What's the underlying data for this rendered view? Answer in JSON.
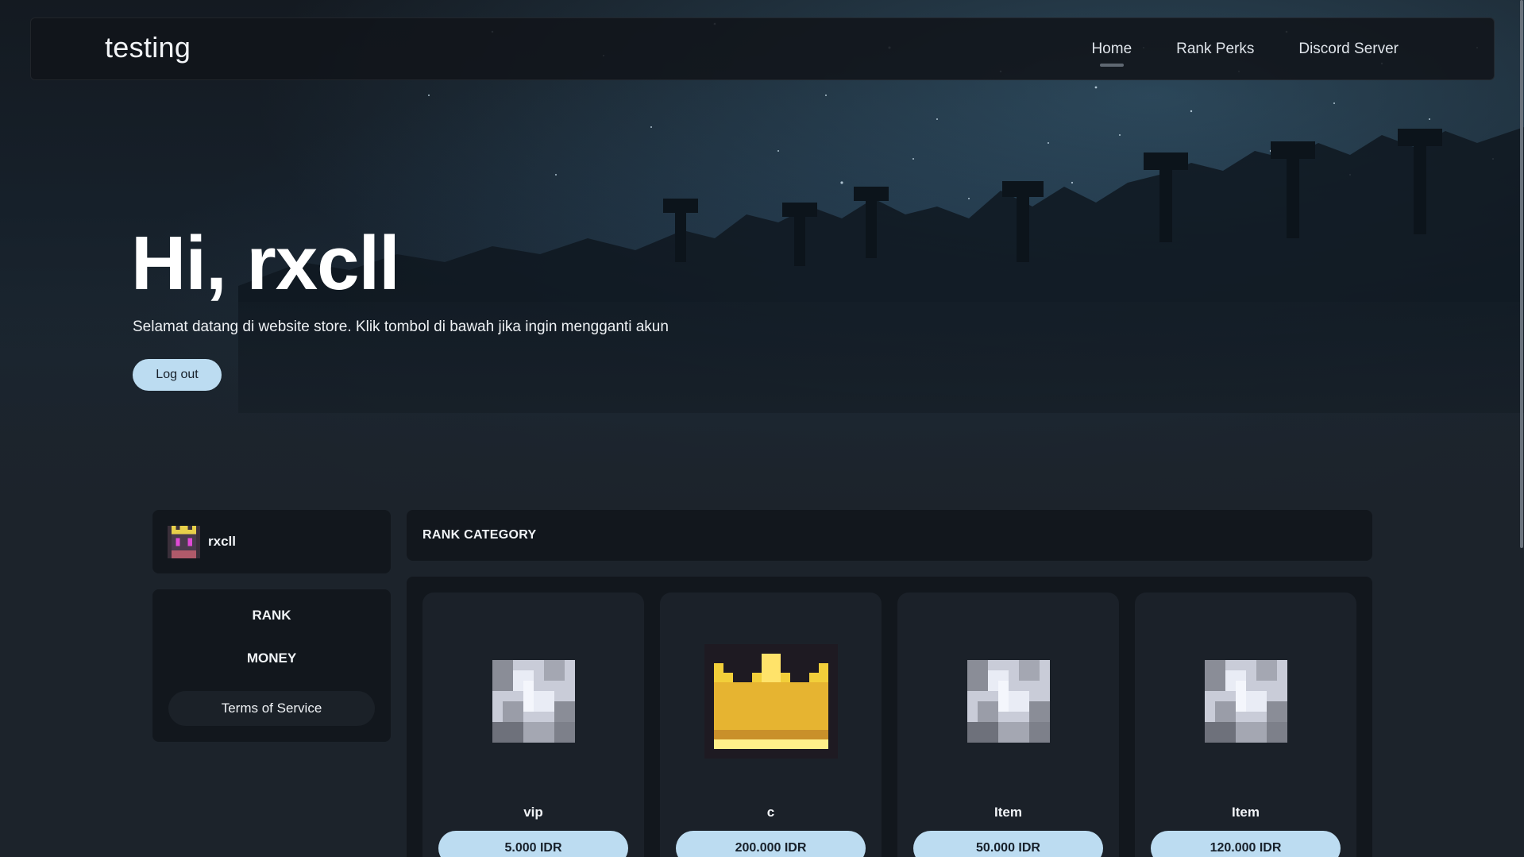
{
  "navbar": {
    "brand": "testing",
    "links": [
      {
        "label": "Home",
        "active": true
      },
      {
        "label": "Rank Perks",
        "active": false
      },
      {
        "label": "Discord Server",
        "active": false
      }
    ]
  },
  "hero": {
    "title": "Hi, rxcll",
    "subtitle": "Selamat datang di website store. Klik tombol di bawah jika ingin mengganti akun",
    "logout_label": "Log out"
  },
  "sidebar": {
    "username": "rxcll",
    "menu": {
      "rank": "RANK",
      "money": "MONEY",
      "tos": "Terms of Service"
    }
  },
  "main": {
    "category_title": "RANK CATEGORY",
    "products": [
      {
        "name": "vip",
        "price": "5.000 IDR",
        "icon": "iron-block-icon"
      },
      {
        "name": "c",
        "price": "200.000 IDR",
        "icon": "gold-crown-icon"
      },
      {
        "name": "Item",
        "price": "50.000 IDR",
        "icon": "iron-block-icon"
      },
      {
        "name": "Item",
        "price": "120.000 IDR",
        "icon": "iron-block-icon"
      }
    ]
  },
  "colors": {
    "accent_button": "#bcdcf1",
    "card_dark": "#12171d",
    "product_card": "#1b2129"
  }
}
